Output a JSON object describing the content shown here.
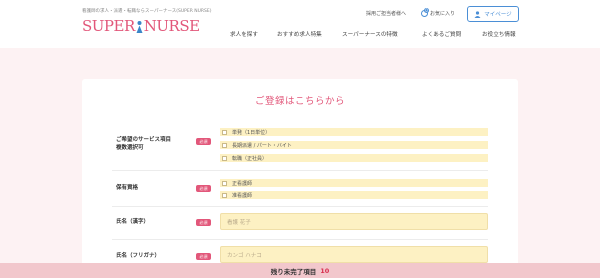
{
  "header": {
    "tagline": "看護師の求人・派遣・転職ならスーパーナース(SUPER NURSE)",
    "logo_left": "SUPER",
    "logo_right": "NURSE",
    "hr_link": "採用ご担当者様へ",
    "fav_label": "お気に入り",
    "fav_count": "0",
    "mypage_label": "マイページ"
  },
  "nav": {
    "items": [
      "求人を探す",
      "おすすめ求人特集",
      "スーパーナースの特徴",
      "よくあるご質問",
      "お役立ち情報"
    ]
  },
  "form": {
    "title": "ご登録はこちらから",
    "required_label": "必須",
    "service": {
      "label_line1": "ご希望のサービス項目",
      "label_line2": "複数選択可",
      "options": [
        "単発（1日単位）",
        "長期派遣 / パート・バイト",
        "転職（正社員）"
      ]
    },
    "license": {
      "label": "保有資格",
      "options": [
        "正看護師",
        "准看護師"
      ]
    },
    "name_kanji": {
      "label": "氏名（漢字）",
      "placeholder": "看護 花子"
    },
    "name_kana": {
      "label": "氏名（フリガナ）",
      "placeholder": "カンゴ ハナコ"
    }
  },
  "status_bar": {
    "label": "残り未完了項目",
    "count": "10"
  },
  "colors": {
    "accent_pink": "#e2577a",
    "input_yellow": "#fdf1c3",
    "link_blue": "#4b8fd6",
    "page_bg": "#fdf2f3"
  }
}
